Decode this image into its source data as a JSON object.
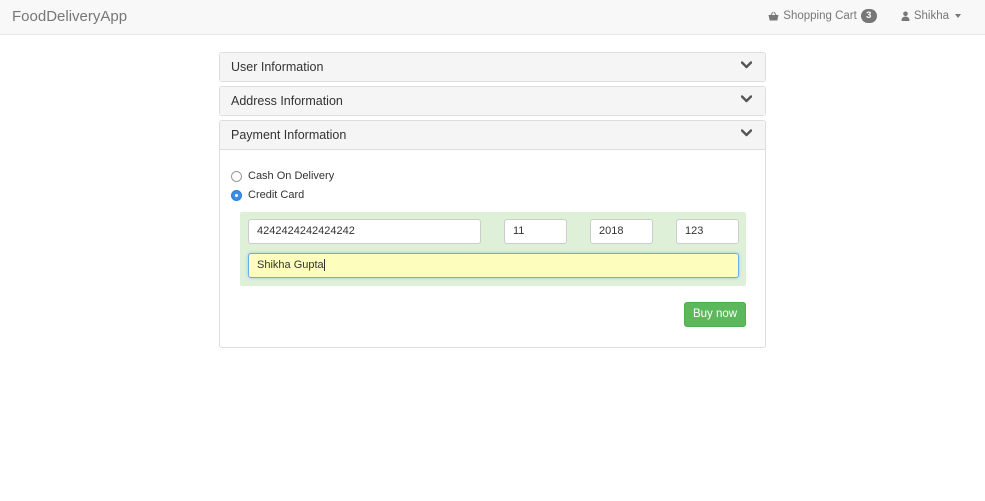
{
  "navbar": {
    "brand": "FoodDeliveryApp",
    "cart_label": "Shopping Cart",
    "cart_count": "3",
    "user_name": "Shikha"
  },
  "panels": [
    {
      "title": "User Information",
      "icon": "chevron-down-icon"
    },
    {
      "title": "Address Information",
      "icon": "chevron-down-icon"
    },
    {
      "title": "Payment Information",
      "icon": "chevron-down-icon"
    }
  ],
  "payment": {
    "options": [
      {
        "label": "Cash On Delivery",
        "selected": false
      },
      {
        "label": "Credit Card",
        "selected": true
      }
    ],
    "card_number": "4242424242424242",
    "exp_month": "11",
    "exp_year": "2018",
    "cvc": "123",
    "card_holder": "Shikha Gupta",
    "buy_label": "Buy now"
  },
  "colors": {
    "accent_green": "#5cb85c",
    "card_box_bg": "#dff0d8",
    "focused_input_bg": "#fdfdbd",
    "radio_selected": "#3a8ee6"
  }
}
